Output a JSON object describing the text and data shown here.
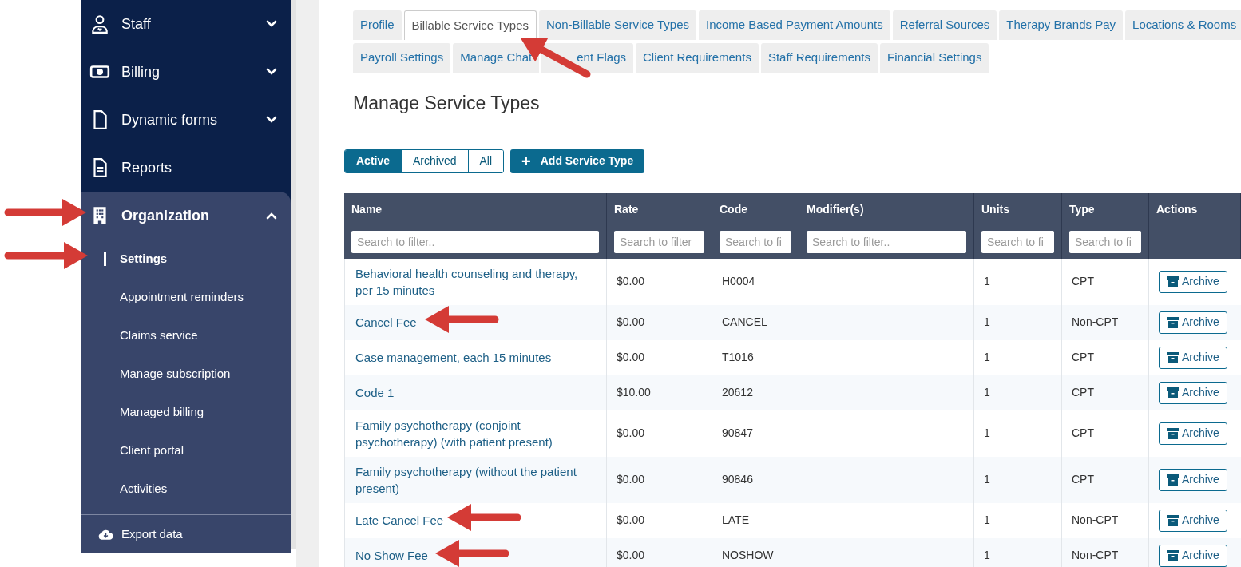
{
  "sidebar": {
    "items": [
      {
        "label": "Staff",
        "kind": "group",
        "expanded": false
      },
      {
        "label": "Billing",
        "kind": "group",
        "expanded": false
      },
      {
        "label": "Dynamic forms",
        "kind": "group",
        "expanded": false
      },
      {
        "label": "Reports",
        "kind": "link"
      },
      {
        "label": "Organization",
        "kind": "group",
        "expanded": true,
        "children": [
          {
            "label": "Settings",
            "selected": true
          },
          {
            "label": "Appointment reminders",
            "selected": false
          },
          {
            "label": "Claims service",
            "selected": false
          },
          {
            "label": "Manage subscription",
            "selected": false
          },
          {
            "label": "Managed billing",
            "selected": false
          },
          {
            "label": "Client portal",
            "selected": false
          },
          {
            "label": "Activities",
            "selected": false
          }
        ]
      }
    ],
    "footer": {
      "label": "Export data"
    }
  },
  "tabs": [
    [
      {
        "label": "Profile",
        "selected": false
      },
      {
        "label": "Billable Service Types",
        "selected": true
      },
      {
        "label": "Non-Billable Service Types",
        "selected": false
      },
      {
        "label": "Income Based Payment Amounts",
        "selected": false
      },
      {
        "label": "Referral Sources",
        "selected": false
      },
      {
        "label": "Therapy Brands Pay",
        "selected": false
      },
      {
        "label": "Locations & Rooms",
        "selected": false
      }
    ],
    [
      {
        "label": "Payroll Settings",
        "selected": false
      },
      {
        "label": "Manage Chat",
        "selected": false
      },
      {
        "label": "ent Flags",
        "selected": false,
        "covered_start": true
      },
      {
        "label": "Client Requirements",
        "selected": false
      },
      {
        "label": "Staff Requirements",
        "selected": false
      },
      {
        "label": "Financial Settings",
        "selected": false
      }
    ]
  ],
  "heading": "Manage Service Types",
  "filters": [
    {
      "label": "Active",
      "selected": true
    },
    {
      "label": "Archived",
      "selected": false
    },
    {
      "label": "All",
      "selected": false
    }
  ],
  "add_button": {
    "icon": "+",
    "label": "Add Service Type"
  },
  "table": {
    "columns": [
      {
        "label": "Name",
        "placeholder": "Search to filter.."
      },
      {
        "label": "Rate",
        "placeholder": "Search to filter"
      },
      {
        "label": "Code",
        "placeholder": "Search to fi"
      },
      {
        "label": "Modifier(s)",
        "placeholder": "Search to filter.."
      },
      {
        "label": "Units",
        "placeholder": "Search to fi"
      },
      {
        "label": "Type",
        "placeholder": "Search to fi"
      },
      {
        "label": "Actions"
      }
    ],
    "rows": [
      {
        "name": "Behavioral health counseling and therapy, per 15 minutes",
        "rate": "$0.00",
        "code": "H0004",
        "units": "1",
        "type": "CPT",
        "action": "Archive"
      },
      {
        "name": "Cancel Fee",
        "rate": "$0.00",
        "code": "CANCEL",
        "units": "1",
        "type": "Non-CPT",
        "action": "Archive"
      },
      {
        "name": "Case management, each 15 minutes",
        "rate": "$0.00",
        "code": "T1016",
        "units": "1",
        "type": "CPT",
        "action": "Archive"
      },
      {
        "name": "Code 1",
        "rate": "$10.00",
        "code": "20612",
        "units": "1",
        "type": "CPT",
        "action": "Archive"
      },
      {
        "name": "Family psychotherapy (conjoint psychotherapy) (with patient present)",
        "rate": "$0.00",
        "code": "90847",
        "units": "1",
        "type": "CPT",
        "action": "Archive"
      },
      {
        "name": "Family psychotherapy (without the patient present)",
        "rate": "$0.00",
        "code": "90846",
        "units": "1",
        "type": "CPT",
        "action": "Archive"
      },
      {
        "name": "Late Cancel Fee",
        "rate": "$0.00",
        "code": "LATE",
        "units": "1",
        "type": "Non-CPT",
        "action": "Archive"
      },
      {
        "name": "No Show Fee",
        "rate": "$0.00",
        "code": "NOSHOW",
        "units": "1",
        "type": "Non-CPT",
        "action": "Archive"
      }
    ]
  }
}
